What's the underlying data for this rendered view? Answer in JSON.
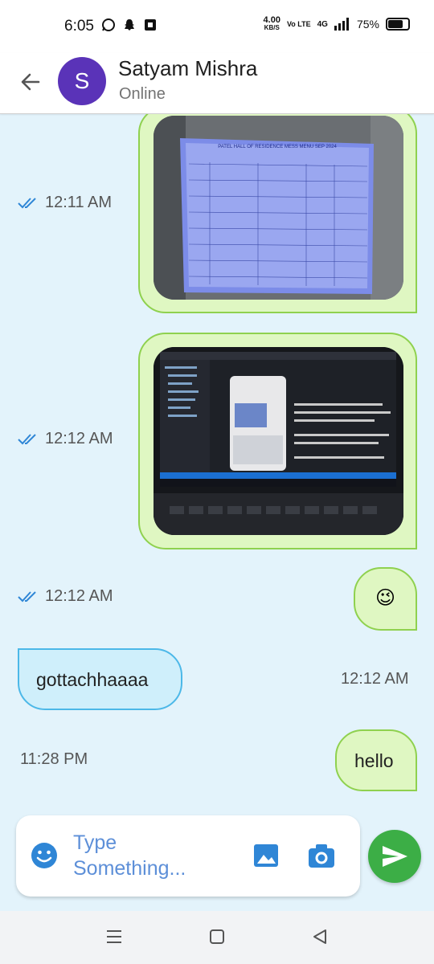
{
  "status_bar": {
    "time": "6:05",
    "speed_value": "4.00",
    "speed_unit": "KB/S",
    "network": "Vo LTE",
    "signal": "4G",
    "battery": "75%"
  },
  "header": {
    "avatar_initial": "S",
    "name": "Satyam Mishra",
    "status": "Online"
  },
  "messages": [
    {
      "type": "image",
      "direction": "sent",
      "time": "12:11 AM",
      "image_text": "PATEL HALL OF RESIDENCE MESS MENU SEP 2024"
    },
    {
      "type": "image",
      "direction": "sent",
      "time": "12:12 AM"
    },
    {
      "type": "text",
      "direction": "sent",
      "time": "12:12 AM",
      "text": "😉"
    },
    {
      "type": "text",
      "direction": "received",
      "time": "12:12 AM",
      "text": "gottachhaaaa"
    },
    {
      "type": "text",
      "direction": "sent",
      "time": "11:28 PM",
      "text": "hello"
    }
  ],
  "input": {
    "placeholder": "Type Something..."
  },
  "colors": {
    "chat_bg": "#e3f3fb",
    "sent_bubble": "#dff7c2",
    "sent_border": "#8fd14f",
    "received_bubble": "#cfeffb",
    "received_border": "#4cb8e8",
    "avatar": "#5a33b8",
    "accent_blue": "#2f86d6",
    "send_button": "#3cae46"
  },
  "icons": [
    "back-arrow-icon",
    "double-check-icon",
    "emoji-icon",
    "gallery-icon",
    "camera-icon",
    "send-icon",
    "menu-icon",
    "home-icon",
    "back-nav-icon"
  ]
}
